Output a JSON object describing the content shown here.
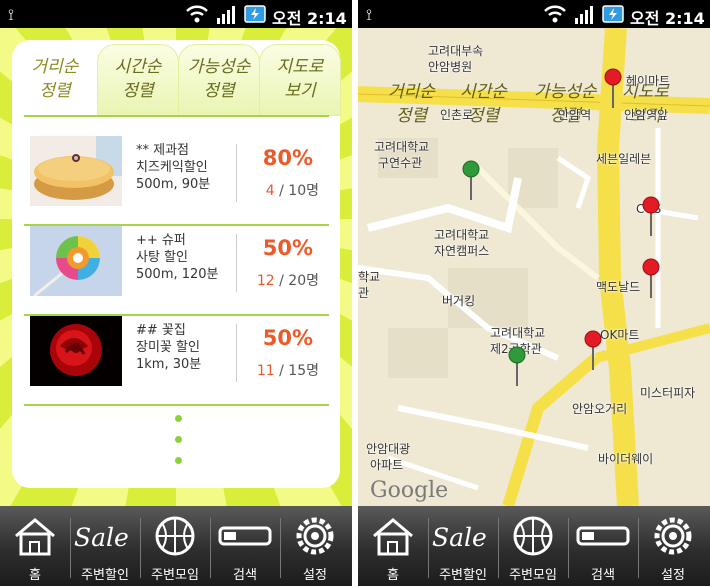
{
  "status_bar": {
    "time": "오전 2:14"
  },
  "tabs": [
    {
      "label": "거리순\n정렬"
    },
    {
      "label": "시간순\n정렬"
    },
    {
      "label": "가능성순\n정렬"
    },
    {
      "label": "지도로\n보기"
    }
  ],
  "deals": [
    {
      "store": "** 제과점",
      "title": "치즈케익할인",
      "meta": "500m, 90분",
      "percent": "80%",
      "current": "4",
      "total": " / 10명",
      "image": "cheesecake"
    },
    {
      "store": "++ 슈퍼",
      "title": "사탕 할인",
      "meta": "500m, 120분",
      "percent": "50%",
      "current": "12",
      "total": " / 20명",
      "image": "lollipop"
    },
    {
      "store": "## 꽃집",
      "title": "장미꽃 할인",
      "meta": "1km, 30분",
      "percent": "50%",
      "current": "11",
      "total": " / 15명",
      "image": "rose"
    }
  ],
  "nav": [
    {
      "label": "홈",
      "icon": "home-icon"
    },
    {
      "label": "주변할인",
      "icon": "sale-icon"
    },
    {
      "label": "주변모임",
      "icon": "basketball-icon"
    },
    {
      "label": "검색",
      "icon": "search-bar-icon"
    },
    {
      "label": "설정",
      "icon": "gear-icon"
    }
  ],
  "nav_sale_word": "Sale",
  "map": {
    "labels": {
      "l1": "고려대부속",
      "l2": "안암병원",
      "l3": "헤이마트",
      "l4": "인촌로",
      "l5": "안암역",
      "l6": "안암역앞",
      "l7": "고려대학교",
      "l8": "구연수관",
      "l9": "세븐일레븐",
      "l10": "CGS",
      "l11": "고려대학교",
      "l12": "자연캠퍼스",
      "l13": "버거킹",
      "l14": "맥도날드",
      "l15": "OK마트",
      "l16": "고려대학교",
      "l17": "제2공학관",
      "l18": "미스터피자",
      "l19": "안암오거리",
      "l20": "안암대광",
      "l21": "아파트",
      "l22": "바이더웨이",
      "l23": "학교",
      "l24": "관"
    },
    "google": "Google"
  },
  "colors": {
    "accent": "#ec5a2a",
    "green": "#a7d54a",
    "sunburst": "#d8ee3a"
  }
}
